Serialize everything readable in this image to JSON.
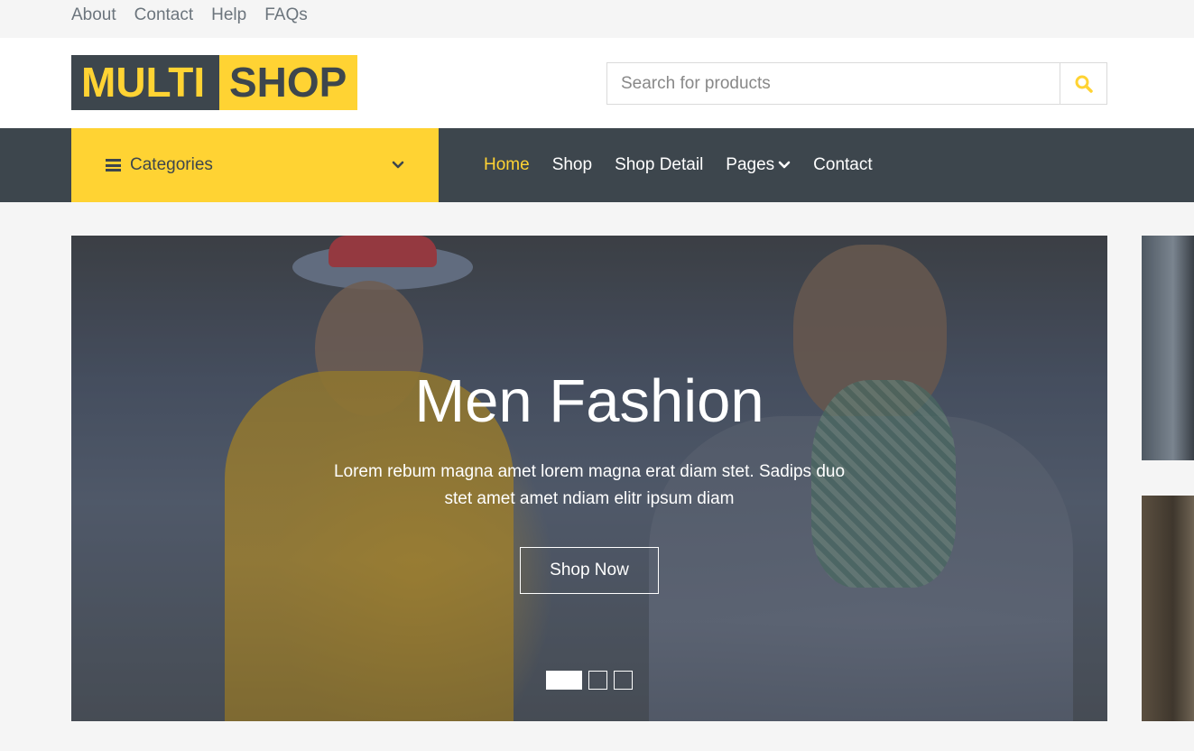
{
  "topbar": {
    "links": [
      "About",
      "Contact",
      "Help",
      "FAQs"
    ]
  },
  "header": {
    "logo": {
      "part1": "MULTI",
      "part2": "SHOP"
    },
    "search": {
      "placeholder": "Search for products",
      "button_icon": "search-icon"
    }
  },
  "navbar": {
    "categories_label": "Categories",
    "categories_icon": "bars-icon",
    "categories_chevron": "chevron-down-icon",
    "links": [
      {
        "label": "Home",
        "active": true
      },
      {
        "label": "Shop",
        "active": false
      },
      {
        "label": "Shop Detail",
        "active": false
      },
      {
        "label": "Pages",
        "active": false,
        "dropdown": true
      },
      {
        "label": "Contact",
        "active": false
      }
    ]
  },
  "carousel": {
    "title": "Men Fashion",
    "text": "Lorem rebum magna amet lorem magna erat diam stet. Sadips duo stet amet amet ndiam elitr ipsum diam",
    "button": "Shop Now",
    "indicator_count": 3,
    "active_indicator": 0
  },
  "colors": {
    "primary": "#ffd333",
    "dark": "#3d464d",
    "light": "#f5f5f5",
    "white": "#ffffff"
  }
}
